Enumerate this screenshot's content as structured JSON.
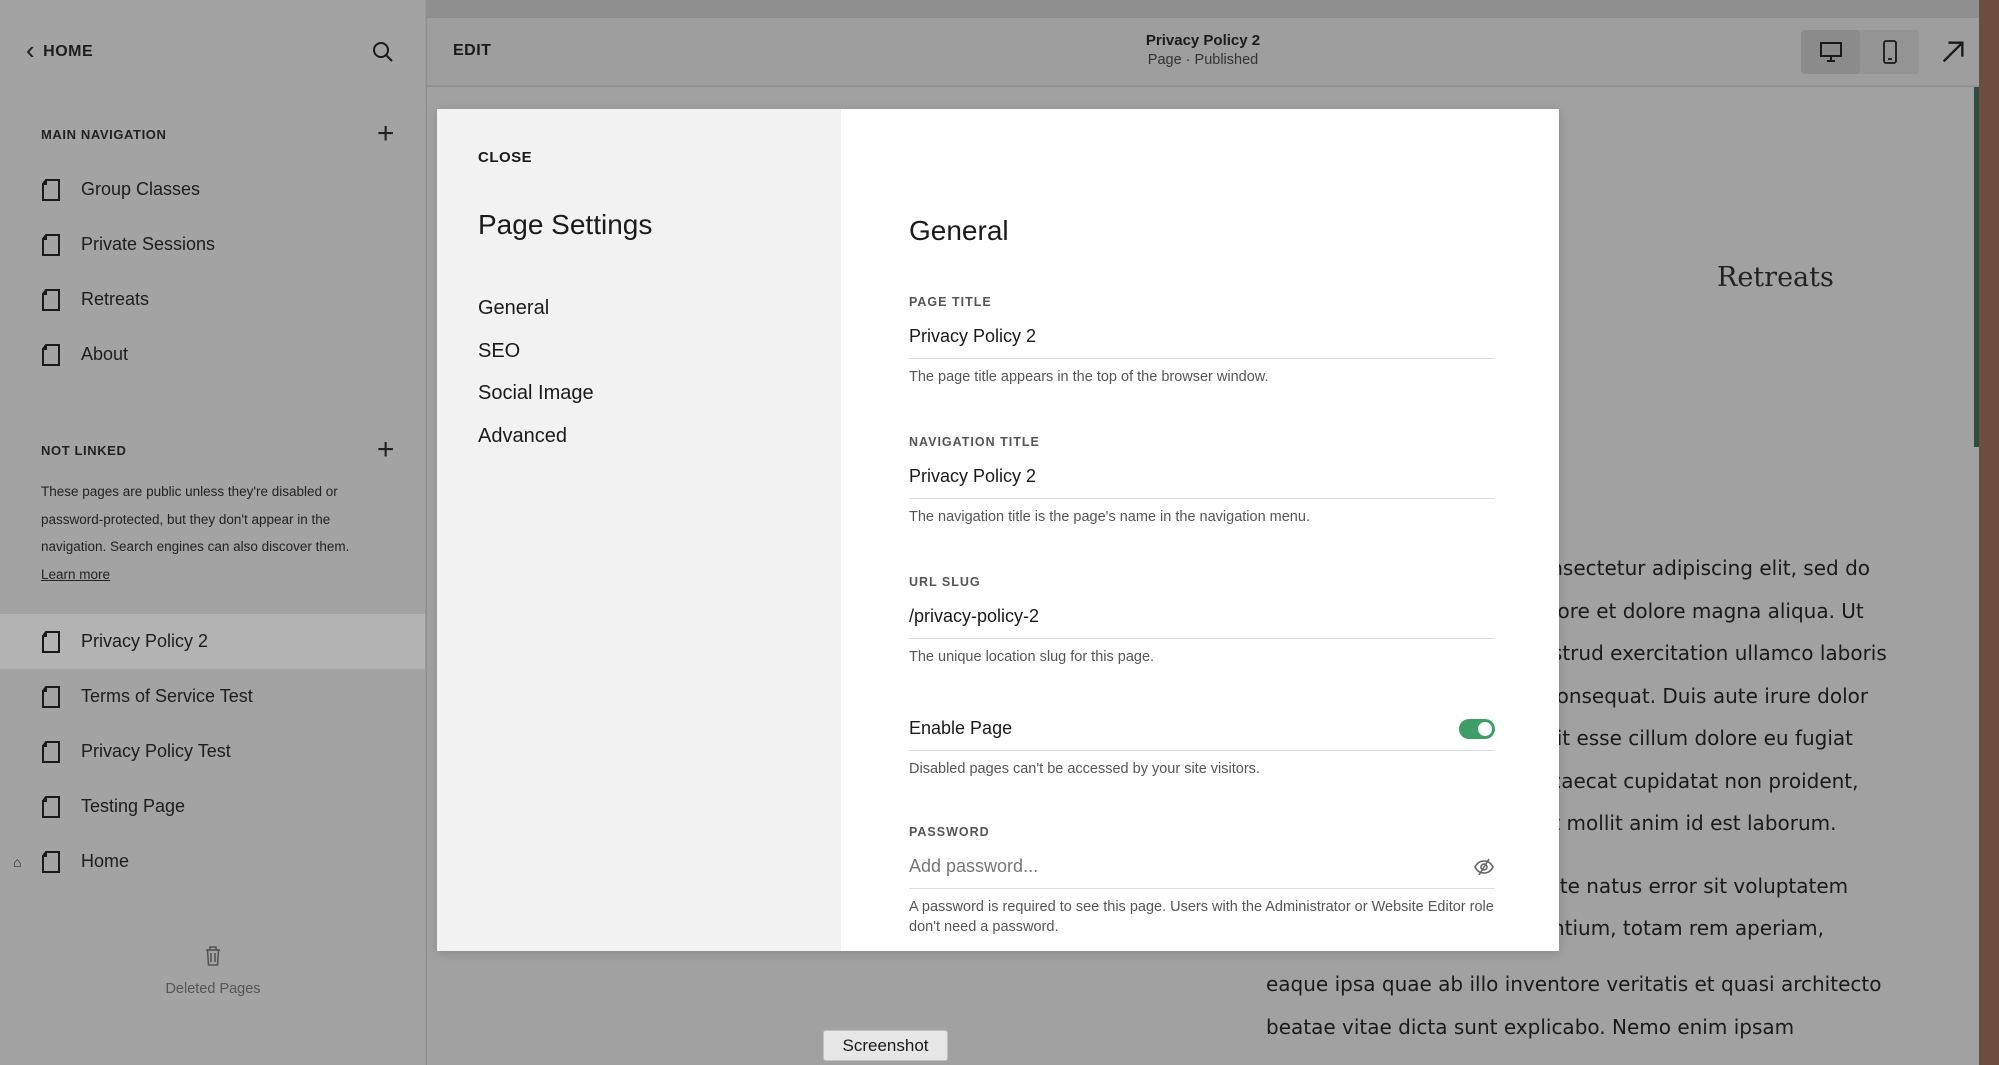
{
  "sidebar": {
    "home_label": "HOME",
    "main_nav_label": "MAIN NAVIGATION",
    "main_items": [
      {
        "label": "Group Classes"
      },
      {
        "label": "Private Sessions"
      },
      {
        "label": "Retreats"
      },
      {
        "label": "About"
      }
    ],
    "not_linked_label": "NOT LINKED",
    "not_linked_desc": "These pages are public unless they're disabled or password-protected, but they don't appear in the navigation. Search engines can also discover them.",
    "learn_more": "Learn more",
    "not_linked_items": [
      {
        "label": "Privacy Policy 2",
        "selected": true
      },
      {
        "label": "Terms of Service Test"
      },
      {
        "label": "Privacy Policy Test"
      },
      {
        "label": "Testing Page"
      },
      {
        "label": "Home",
        "is_homepage": true
      }
    ],
    "deleted_label": "Deleted Pages"
  },
  "topbar": {
    "edit_label": "EDIT",
    "page_title": "Privacy Policy 2",
    "page_status": "Page · Published",
    "icons": [
      "desktop-icon",
      "mobile-icon",
      "open-external-icon"
    ]
  },
  "preview": {
    "heading": "Retreats",
    "lines": [
      "consectetur adipiscing elit, sed do",
      " labore et dolore magna aliqua. Ut",
      "nostrud exercitation ullamco laboris",
      "o consequat. Duis aute irure dolor",
      "velit esse cillum dolore eu fugiat",
      "occaecat cupidatat non proident,",
      "unt mollit anim id est laborum."
    ],
    "lines2": [
      "s iste natus error sit voluptatem",
      "dantium, totam rem aperiam,"
    ],
    "lines3": [
      "eaque ipsa quae ab illo inventore veritatis et quasi architecto",
      "beatae vitae dicta sunt explicabo. Nemo enim ipsam"
    ]
  },
  "modal": {
    "close_label": "CLOSE",
    "settings_title": "Page Settings",
    "nav": [
      "General",
      "SEO",
      "Social Image",
      "Advanced"
    ],
    "section_title": "General",
    "page_title_field": {
      "label": "PAGE TITLE",
      "value": "Privacy Policy 2",
      "help": "The page title appears in the top of the browser window."
    },
    "nav_title_field": {
      "label": "NAVIGATION TITLE",
      "value": "Privacy Policy 2",
      "help": "The navigation title is the page's name in the navigation menu."
    },
    "url_slug_field": {
      "label": "URL SLUG",
      "value": "/privacy-policy-2",
      "help": "The unique location slug for this page."
    },
    "enable_page": {
      "label": "Enable Page",
      "enabled": true,
      "help": "Disabled pages can't be accessed by your site visitors."
    },
    "password_field": {
      "label": "PASSWORD",
      "placeholder": "Add password...",
      "help": "A password is required to see this page. Users with the Administrator or Website Editor role don't need a password."
    }
  },
  "screenshot_label": "Screenshot",
  "colors": {
    "toggle_on": "#3f9e67",
    "accent_green": "#2d4d40"
  }
}
